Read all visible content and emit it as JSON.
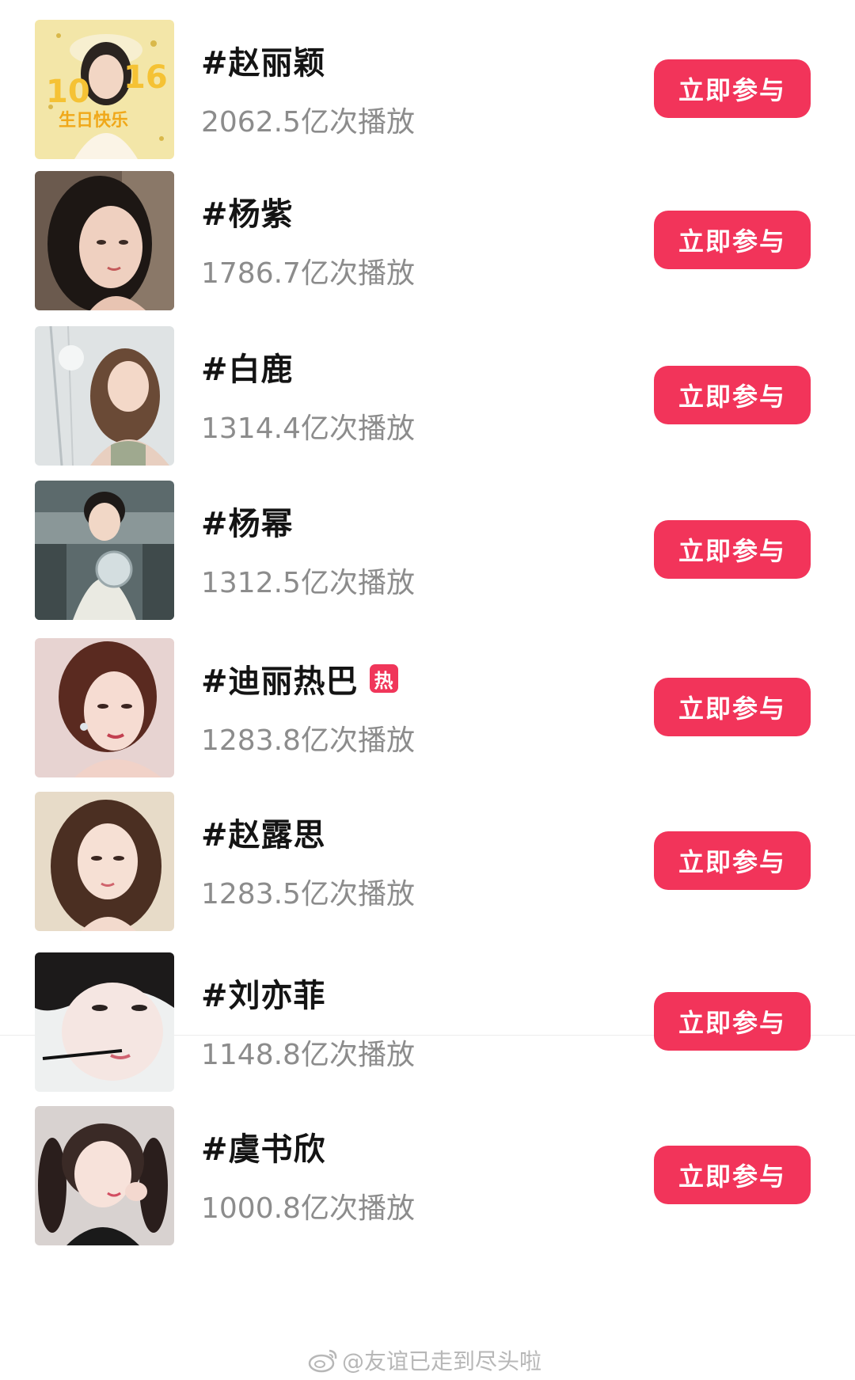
{
  "topics": [
    {
      "title": "#赵丽颖",
      "plays": "2062.5亿次播放",
      "button": "立即参与",
      "hot": false,
      "thumb_text_year": "10",
      "thumb_text_num": "16",
      "thumb_text_bday": "生日快乐"
    },
    {
      "title": "#杨紫",
      "plays": "1786.7亿次播放",
      "button": "立即参与",
      "hot": false
    },
    {
      "title": "#白鹿",
      "plays": "1314.4亿次播放",
      "button": "立即参与",
      "hot": false
    },
    {
      "title": "#杨幂",
      "plays": "1312.5亿次播放",
      "button": "立即参与",
      "hot": false
    },
    {
      "title": "#迪丽热巴",
      "plays": "1283.8亿次播放",
      "button": "立即参与",
      "hot": true,
      "hot_label": "热"
    },
    {
      "title": "#赵露思",
      "plays": "1283.5亿次播放",
      "button": "立即参与",
      "hot": false
    },
    {
      "title": "#刘亦菲",
      "plays": "1148.8亿次播放",
      "button": "立即参与",
      "hot": false
    },
    {
      "title": "#虞书欣",
      "plays": "1000.8亿次播放",
      "button": "立即参与",
      "hot": false
    }
  ],
  "watermark": "@友谊已走到尽头啦",
  "colors": {
    "accent": "#f2345a",
    "title": "#141414",
    "subtitle": "#8c8c8c"
  }
}
